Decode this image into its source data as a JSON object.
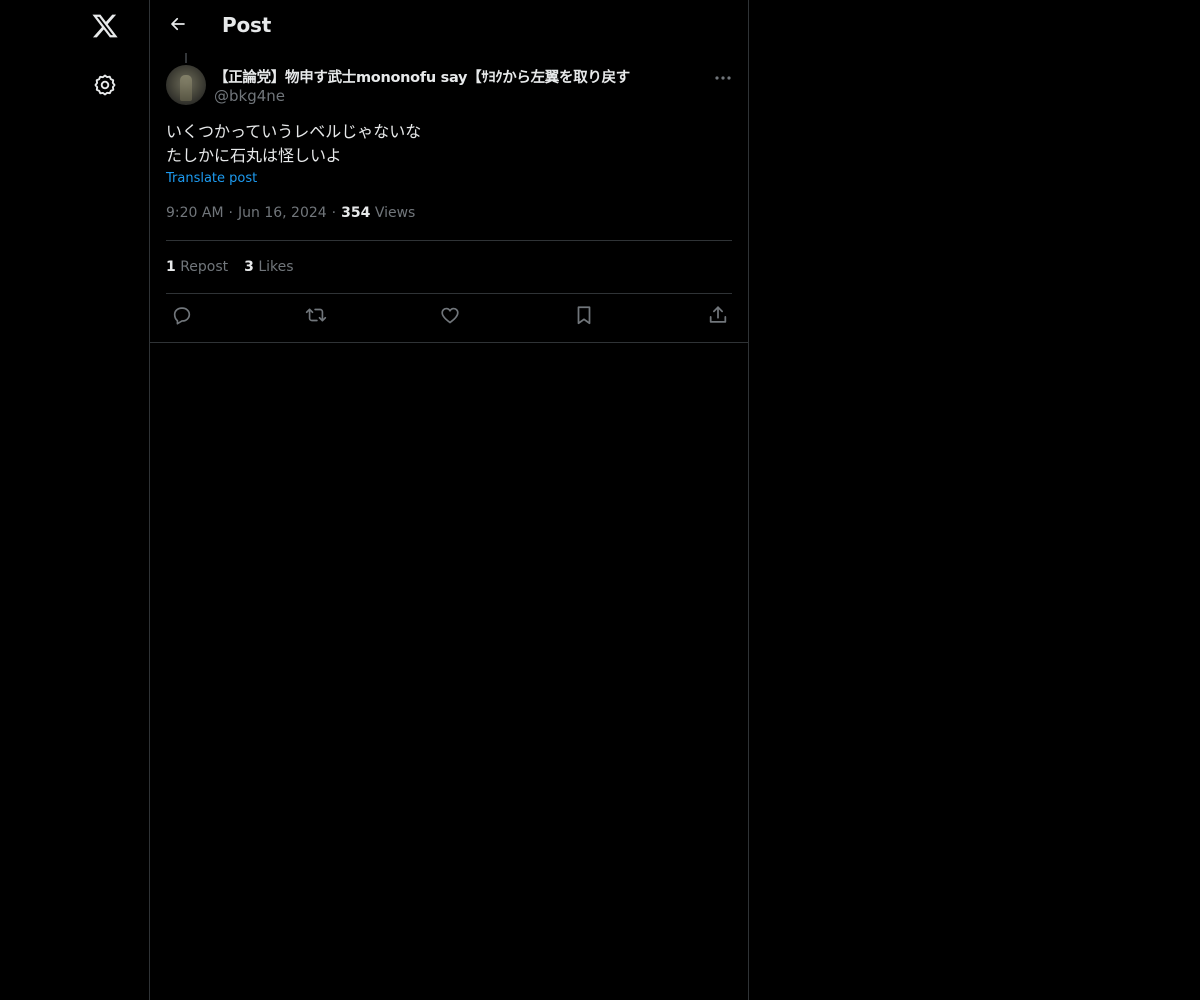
{
  "nav": {
    "logo_icon": "x-logo-icon",
    "settings_icon": "gear-icon"
  },
  "header": {
    "title": "Post",
    "back_icon": "arrow-left-icon"
  },
  "post": {
    "author": {
      "display_name": "【正論党】物申す武士mononofu say【ｻﾖｸから左翼を取り戻す",
      "handle": "@bkg4ne"
    },
    "body_lines": [
      "いくつかっていうレベルじゃないな",
      "たしかに石丸は怪しいよ"
    ],
    "translate_label": "Translate post",
    "time": "9:20 AM",
    "date": "Jun 16, 2024",
    "views_count": "354",
    "views_label": "Views",
    "reposts_count": "1",
    "reposts_label": "Repost",
    "likes_count": "3",
    "likes_label": "Likes"
  },
  "colors": {
    "background": "#000000",
    "text": "#e7e9ea",
    "muted": "#71767b",
    "link": "#1d9bf0",
    "border": "#2f3336"
  }
}
